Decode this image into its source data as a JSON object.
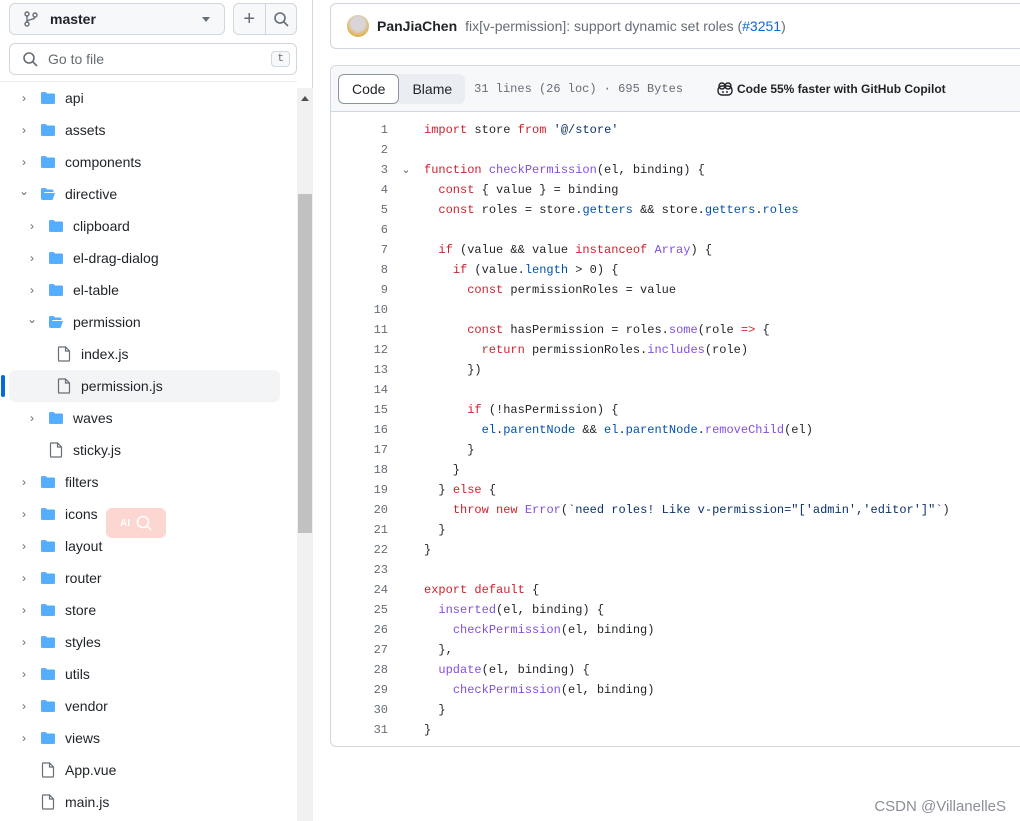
{
  "sidebar": {
    "branch": "master",
    "goto_placeholder": "Go to file",
    "goto_shortcut": "t",
    "tree": [
      {
        "name": "api",
        "type": "folder",
        "level": 0,
        "open": false
      },
      {
        "name": "assets",
        "type": "folder",
        "level": 0,
        "open": false
      },
      {
        "name": "components",
        "type": "folder",
        "level": 0,
        "open": false
      },
      {
        "name": "directive",
        "type": "folder",
        "level": 0,
        "open": true
      },
      {
        "name": "clipboard",
        "type": "folder",
        "level": 1,
        "open": false
      },
      {
        "name": "el-drag-dialog",
        "type": "folder",
        "level": 1,
        "open": false
      },
      {
        "name": "el-table",
        "type": "folder",
        "level": 1,
        "open": false
      },
      {
        "name": "permission",
        "type": "folder",
        "level": 1,
        "open": true
      },
      {
        "name": "index.js",
        "type": "file",
        "level": 2
      },
      {
        "name": "permission.js",
        "type": "file",
        "level": 2,
        "selected": true
      },
      {
        "name": "waves",
        "type": "folder",
        "level": 1,
        "open": false
      },
      {
        "name": "sticky.js",
        "type": "file",
        "level": 1
      },
      {
        "name": "filters",
        "type": "folder",
        "level": 0,
        "open": false
      },
      {
        "name": "icons",
        "type": "folder",
        "level": 0,
        "open": false
      },
      {
        "name": "layout",
        "type": "folder",
        "level": 0,
        "open": false
      },
      {
        "name": "router",
        "type": "folder",
        "level": 0,
        "open": false
      },
      {
        "name": "store",
        "type": "folder",
        "level": 0,
        "open": false
      },
      {
        "name": "styles",
        "type": "folder",
        "level": 0,
        "open": false
      },
      {
        "name": "utils",
        "type": "folder",
        "level": 0,
        "open": false
      },
      {
        "name": "vendor",
        "type": "folder",
        "level": 0,
        "open": false
      },
      {
        "name": "views",
        "type": "folder",
        "level": 0,
        "open": false
      },
      {
        "name": "App.vue",
        "type": "file",
        "level": 0
      },
      {
        "name": "main.js",
        "type": "file",
        "level": 0
      }
    ],
    "overlay_badge": "AI"
  },
  "commit": {
    "author": "PanJiaChen",
    "message": "fix[v-permission]: support dynamic set roles (",
    "pr": "#3251",
    "close": ")"
  },
  "toolbar": {
    "code_tab": "Code",
    "blame_tab": "Blame",
    "meta": "31 lines (26 loc) · 695 Bytes",
    "copilot": "Code 55% faster with GitHub Copilot"
  },
  "colors": {
    "keyword": "#cf222e",
    "function": "#8250df",
    "property": "#0550ae",
    "string": "#0a3069",
    "folder": "#54aeff",
    "accent": "#0969da"
  },
  "code": [
    [
      [
        "import",
        "k"
      ],
      " store ",
      [
        "from",
        "k"
      ],
      " ",
      [
        "'@/store'",
        "s"
      ]
    ],
    [],
    [
      [
        "function",
        "k"
      ],
      " ",
      [
        "checkPermission",
        "f"
      ],
      "(el, binding) {"
    ],
    [
      "  ",
      [
        "const",
        "k"
      ],
      " { value } = binding"
    ],
    [
      "  ",
      [
        "const",
        "k"
      ],
      " roles = store.",
      [
        "getters",
        "p"
      ],
      " && store.",
      [
        "getters",
        "p"
      ],
      ".",
      [
        "roles",
        "p"
      ]
    ],
    [],
    [
      "  ",
      [
        "if",
        "k"
      ],
      " (value && value ",
      [
        "instanceof",
        "k"
      ],
      " ",
      [
        "Array",
        "f"
      ],
      ") {"
    ],
    [
      "    ",
      [
        "if",
        "k"
      ],
      " (value.",
      [
        "length",
        "p"
      ],
      " > 0) {"
    ],
    [
      "      ",
      [
        "const",
        "k"
      ],
      " permissionRoles = value"
    ],
    [],
    [
      "      ",
      [
        "const",
        "k"
      ],
      " hasPermission = roles.",
      [
        "some",
        "f"
      ],
      "(role ",
      [
        "=>",
        "k"
      ],
      " {"
    ],
    [
      "        ",
      [
        "return",
        "k"
      ],
      " permissionRoles.",
      [
        "includes",
        "f"
      ],
      "(role)"
    ],
    [
      "      })"
    ],
    [],
    [
      "      ",
      [
        "if",
        "k"
      ],
      " (!hasPermission) {"
    ],
    [
      "        ",
      [
        "el",
        "p"
      ],
      ".",
      [
        "parentNode",
        "p"
      ],
      " && ",
      [
        "el",
        "p"
      ],
      ".",
      [
        "parentNode",
        "p"
      ],
      ".",
      [
        "removeChild",
        "f"
      ],
      "(el)"
    ],
    [
      "      }"
    ],
    [
      "    }"
    ],
    [
      "  } ",
      [
        "else",
        "k"
      ],
      " {"
    ],
    [
      "    ",
      [
        "throw",
        "k"
      ],
      " ",
      [
        "new",
        "k"
      ],
      " ",
      [
        "Error",
        "f"
      ],
      "(",
      [
        "`need roles! Like v-permission=\"['admin','editor']\"`",
        "s"
      ],
      ")"
    ],
    [
      "  }"
    ],
    [
      "}"
    ],
    [],
    [
      [
        "export",
        "k"
      ],
      " ",
      [
        "default",
        "k"
      ],
      " {"
    ],
    [
      "  ",
      [
        "inserted",
        "f"
      ],
      "(el, binding) {"
    ],
    [
      "    ",
      [
        "checkPermission",
        "f"
      ],
      "(el, binding)"
    ],
    [
      "  },"
    ],
    [
      "  ",
      [
        "update",
        "f"
      ],
      "(el, binding) {"
    ],
    [
      "    ",
      [
        "checkPermission",
        "f"
      ],
      "(el, binding)"
    ],
    [
      "  }"
    ],
    [
      "}"
    ]
  ],
  "folded_lines": [
    3
  ],
  "watermark": "CSDN @VillanelleS"
}
